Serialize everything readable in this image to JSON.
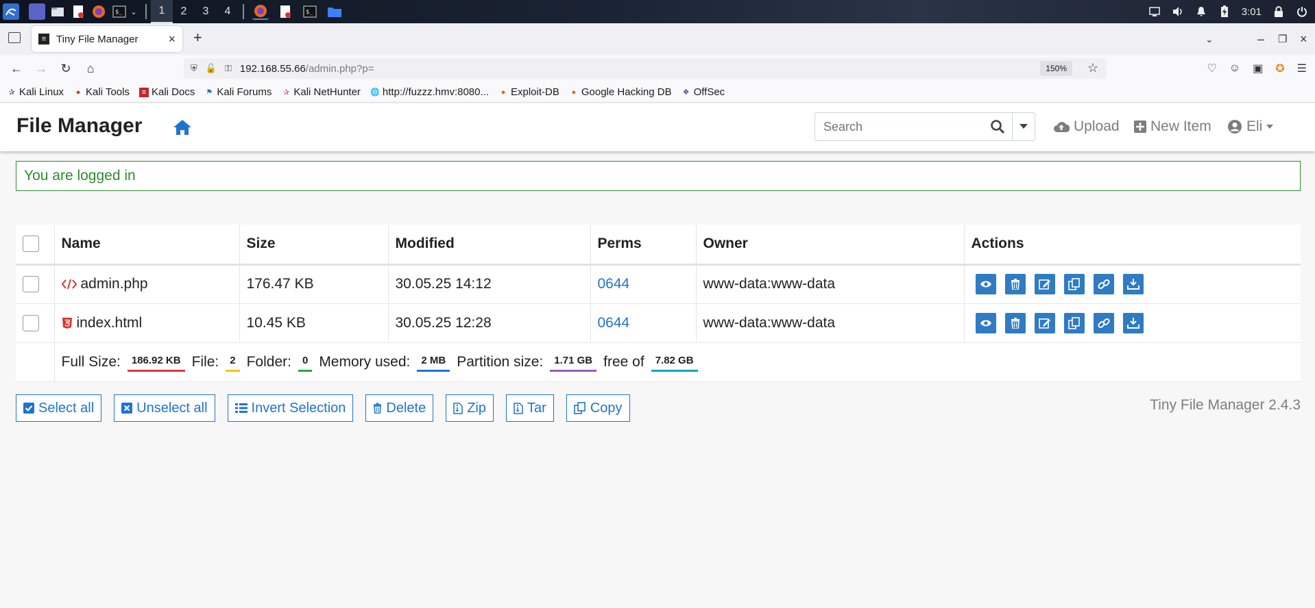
{
  "taskbar": {
    "workspaces": [
      "1",
      "2",
      "3",
      "4"
    ],
    "clock": "3:01"
  },
  "browser": {
    "tab_title": "Tiny File Manager",
    "url_host": "192.168.55.66",
    "url_path": "/admin.php?p=",
    "zoom": "150%",
    "bookmarks": [
      "Kali Linux",
      "Kali Tools",
      "Kali Docs",
      "Kali Forums",
      "Kali NetHunter",
      "http://fuzzz.hmv:8080...",
      "Exploit-DB",
      "Google Hacking DB",
      "OffSec"
    ]
  },
  "header": {
    "brand": "File Manager",
    "search_placeholder": "Search",
    "upload_label": "Upload",
    "new_item_label": "New Item",
    "user_label": "Eli"
  },
  "alert": {
    "message": "You are logged in"
  },
  "table": {
    "columns": [
      "Name",
      "Size",
      "Modified",
      "Perms",
      "Owner",
      "Actions"
    ],
    "rows": [
      {
        "name": "admin.php",
        "size": "176.47 KB",
        "modified": "30.05.25 14:12",
        "perms": "0644",
        "owner": "www-data:www-data"
      },
      {
        "name": "index.html",
        "size": "10.45 KB",
        "modified": "30.05.25 12:28",
        "perms": "0644",
        "owner": "www-data:www-data"
      }
    ],
    "footer": {
      "full_size_label": "Full Size:",
      "full_size": "186.92 KB",
      "file_label": "File:",
      "file_count": "2",
      "folder_label": "Folder:",
      "folder_count": "0",
      "memory_label": "Memory used:",
      "memory": "2 MB",
      "partition_label": "Partition size:",
      "partition": "1.71 GB",
      "free_label": "free of",
      "total": "7.82 GB"
    }
  },
  "buttons": {
    "select_all": "Select all",
    "unselect_all": "Unselect all",
    "invert": "Invert Selection",
    "delete": "Delete",
    "zip": "Zip",
    "tar": "Tar",
    "copy": "Copy"
  },
  "version": "Tiny File Manager 2.4.3",
  "colors": {
    "accent": "#1e73d2",
    "action_button": "#2f7bc4",
    "success": "#2e8b2e",
    "badge_full_size": "#dc3545",
    "badge_file": "#ffc107",
    "badge_folder": "#28a745",
    "badge_memory": "#1e73d2",
    "badge_partition": "#9b59b6",
    "badge_total": "#17a2b8"
  }
}
